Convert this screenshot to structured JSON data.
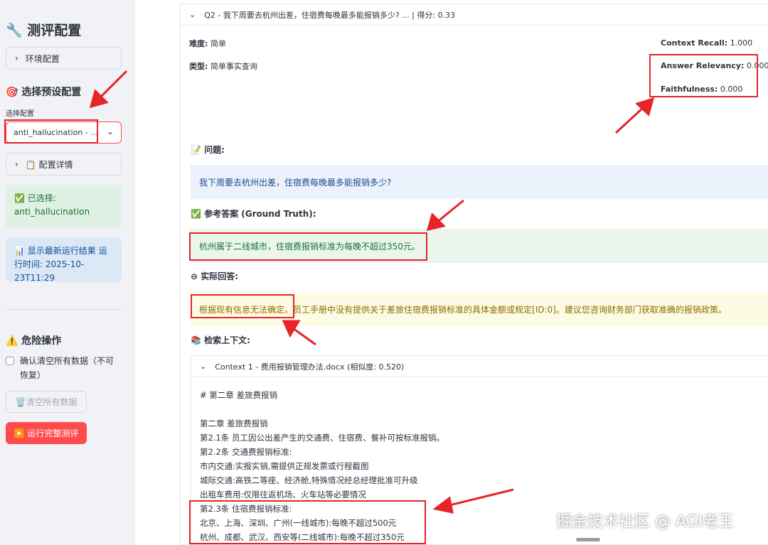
{
  "sidebar": {
    "title": "🔧 测评配置",
    "env_expander": "环境配置",
    "preset_heading": "🎯 选择预设配置",
    "select_label": "选择配置",
    "select_value": "anti_hallucination - ...",
    "details_expander": "📋 配置详情",
    "selected_line1": "✅ 已选择:",
    "selected_line2": "anti_hallucination",
    "run_info_line1": "📊 显示最新运行结果 运",
    "run_info_line2": "行时间: 2025-10-23T11:29",
    "danger_heading": "⚠️ 危险操作",
    "confirm_line1": "确认清空所有数据（不可",
    "confirm_line2": "恢复）",
    "clear_button": "🗑️清空所有数据",
    "run_button": "▶️ 运行完整测评"
  },
  "main": {
    "question_header": "Q2 - 我下周要去杭州出差，住宿费每晚最多能报销多少? ... | 得分: 0.33",
    "difficulty_label": "难度:",
    "difficulty_value": "简单",
    "type_label": "类型:",
    "type_value": "简单事实查询",
    "metrics": [
      {
        "label": "Context Recall:",
        "value": "1.000"
      },
      {
        "label": "Answer Relevancy:",
        "value": "0.000"
      },
      {
        "label": "Faithfulness:",
        "value": "0.000"
      }
    ],
    "question_heading": "📝 问题:",
    "question_text": "我下周要去杭州出差，住宿费每晚最多能报销多少?",
    "ground_truth_heading": "✅ 参考答案 (Ground Truth):",
    "ground_truth_text": "杭州属于二线城市，住宿费报销标准为每晚不超过350元。",
    "answer_heading": "⊖ 实际回答:",
    "answer_text_a": "根据现有信息无法确定。",
    "answer_text_b": "员工手册中没有提供关于差旅住宿费报销标准的具体金额或规定[ID:0]。建议您咨询财务部门获取准确的报销政策。",
    "context_heading": "📚 检索上下文:",
    "context_header": "Context 1 - 费用报销管理办法.docx (相似度: 0.520)",
    "context_lines": [
      "# 第二章 差旅费报销",
      "",
      "第二章 差旅费报销",
      "第2.1条 员工因公出差产生的交通费、住宿费、餐补可按标准报销。",
      "第2.2条 交通费报销标准:",
      "市内交通:实报实销,需提供正规发票或行程截图",
      "城际交通:高铁二等座、经济舱,特殊情况经总经理批准可升级",
      "出租车费用:仅限往返机场、火车站等必要情况",
      "第2.3条 住宿费报销标准:",
      "北京、上海、深圳、广州(一线城市):每晚不超过500元",
      "杭州、成都、武汉、西安等(二线城市):每晚不超过350元"
    ]
  },
  "watermark": "掘金技术社区 @ AGI老王",
  "colors": {
    "accent": "#ff4b4b",
    "annotation": "#e8232a"
  }
}
